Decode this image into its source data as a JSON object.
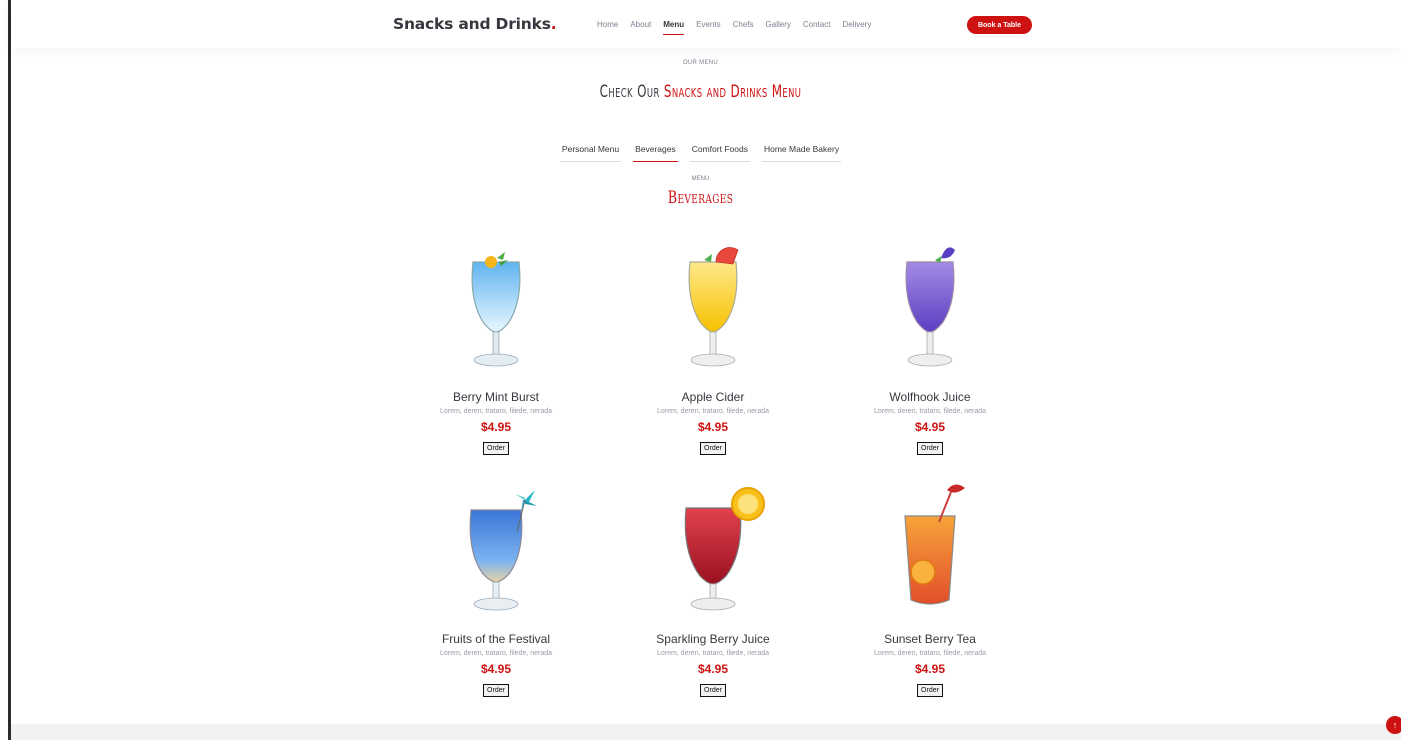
{
  "header": {
    "logo": "Snacks and Drinks",
    "logo_dot": ".",
    "nav": [
      "Home",
      "About",
      "Menu",
      "Events",
      "Chefs",
      "Gallery",
      "Contact",
      "Delivery"
    ],
    "active_nav": "Menu",
    "book_label": "Book a Table"
  },
  "section": {
    "subtitle": "OUR MENU",
    "title_prefix": "Check Our ",
    "title_highlight": "Snacks and Drinks Menu"
  },
  "tabs": [
    {
      "label": "Personal Menu",
      "active": false
    },
    {
      "label": "Beverages",
      "active": true
    },
    {
      "label": "Comfort Foods",
      "active": false
    },
    {
      "label": "Home Made Bakery",
      "active": false
    }
  ],
  "menu": {
    "subtitle": "MENU",
    "title": "Beverages",
    "order_label": "Order",
    "items": [
      {
        "name": "Berry Mint Burst",
        "desc": "Lorem, deren, trataro, filede, nerada",
        "price": "$4.95"
      },
      {
        "name": "Apple Cider",
        "desc": "Lorem, deren, trataro, filede, nerada",
        "price": "$4.95"
      },
      {
        "name": "Wolfhook Juice",
        "desc": "Lorem, deren, trataro, filede, nerada",
        "price": "$4.95"
      },
      {
        "name": "Fruits of the Festival",
        "desc": "Lorem, deren, trataro, filede, nerada",
        "price": "$4.95"
      },
      {
        "name": "Sparkling Berry Juice",
        "desc": "Lorem, deren, trataro, filede, nerada",
        "price": "$4.95"
      },
      {
        "name": "Sunset Berry Tea",
        "desc": "Lorem, deren, trataro, filede, nerada",
        "price": "$4.95"
      }
    ]
  },
  "colors": {
    "accent": "#ce1212",
    "text": "#37373f",
    "muted": "#7f7f90"
  },
  "icons": {
    "scroll_top": "arrow-up-icon"
  }
}
